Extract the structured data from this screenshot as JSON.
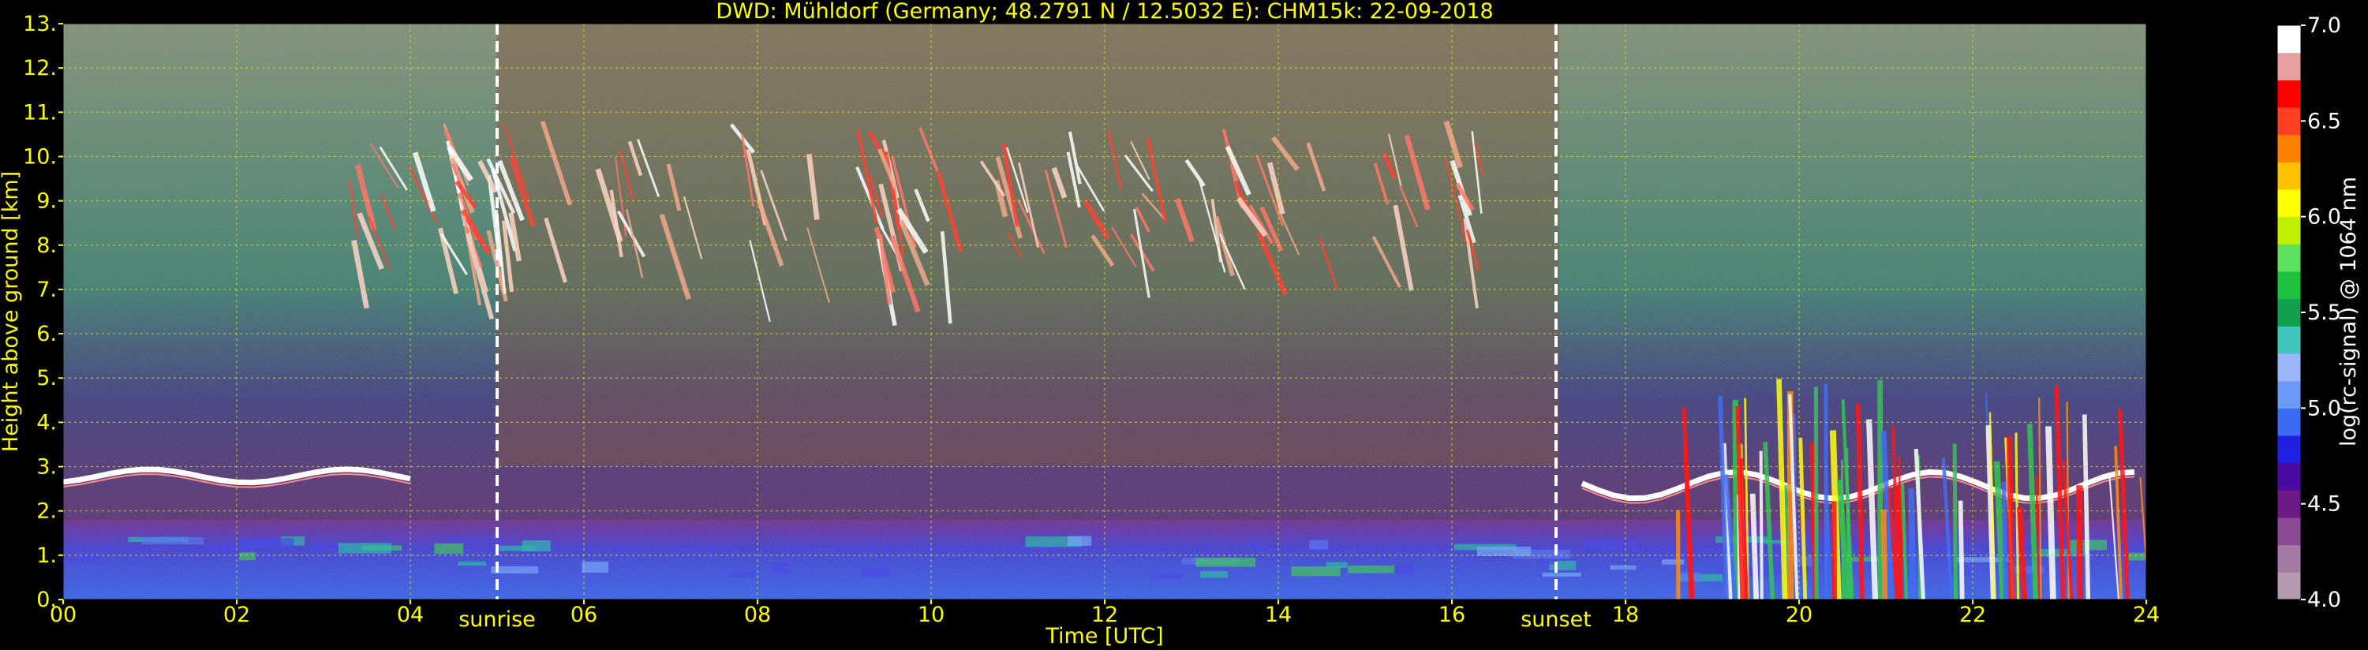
{
  "chart_data": {
    "type": "heatmap",
    "title": "DWD: Mühldorf (Germany; 48.2791 N / 12.5032 E):    CHM15k: 22-09-2018",
    "xlabel": "Time [UTC]",
    "ylabel": "Height above ground [km]",
    "xlim": [
      0,
      24
    ],
    "ylim": [
      0,
      13
    ],
    "x_ticks": [
      0,
      2,
      4,
      6,
      8,
      10,
      12,
      14,
      16,
      18,
      20,
      22,
      24
    ],
    "x_tick_labels": [
      "00",
      "02",
      "04",
      "06",
      "08",
      "10",
      "12",
      "14",
      "16",
      "18",
      "20",
      "22",
      "24"
    ],
    "y_ticks": [
      0,
      1,
      2,
      3,
      4,
      5,
      6,
      7,
      8,
      9,
      10,
      11,
      12,
      13
    ],
    "y_tick_labels": [
      "0.",
      "1.",
      "2.",
      "3.",
      "4.",
      "5.",
      "6.",
      "7.",
      "8.",
      "9.",
      "10.",
      "11.",
      "12.",
      "13."
    ],
    "grid": true,
    "markers": [
      {
        "label": "sunrise",
        "x": 5.0
      },
      {
        "label": "sunset",
        "x": 17.2
      }
    ],
    "colorbar": {
      "label": "log(rc-signal) @ 1064 nm",
      "range": [
        4.0,
        7.0
      ],
      "ticks": [
        4.0,
        4.5,
        5.0,
        5.5,
        6.0,
        6.5,
        7.0
      ],
      "tick_labels": [
        "4.0",
        "4.5",
        "5.0",
        "5.5",
        "6.0",
        "6.5",
        "7.0"
      ],
      "colors": [
        "#b49ab0",
        "#a47aa6",
        "#8c4a96",
        "#6c1a86",
        "#4a0aa2",
        "#2020e0",
        "#3a6af0",
        "#6a9af5",
        "#9ab8f8",
        "#40c8c0",
        "#10a050",
        "#20c040",
        "#60e060",
        "#c0f000",
        "#ffff00",
        "#ffc000",
        "#ff8000",
        "#ff4020",
        "#ff0000",
        "#e8a0a0",
        "#ffffff"
      ]
    },
    "features": [
      {
        "name": "cirrus",
        "x_range": [
          3.3,
          16.6
        ],
        "height_range": [
          5.8,
          10.8
        ]
      },
      {
        "name": "elevated-layer",
        "x_range": [
          0.0,
          4.0
        ],
        "height_range": [
          2.4,
          3.0
        ]
      },
      {
        "name": "elevated-layer",
        "x_range": [
          17.5,
          24.0
        ],
        "height_range": [
          1.8,
          3.0
        ]
      },
      {
        "name": "boundary-layer",
        "x_range": [
          0.0,
          24.0
        ],
        "height_range": [
          0.0,
          1.8
        ]
      },
      {
        "name": "low-clouds",
        "x_range": [
          18.5,
          24.0
        ],
        "height_range": [
          0.0,
          5.0
        ]
      }
    ]
  }
}
